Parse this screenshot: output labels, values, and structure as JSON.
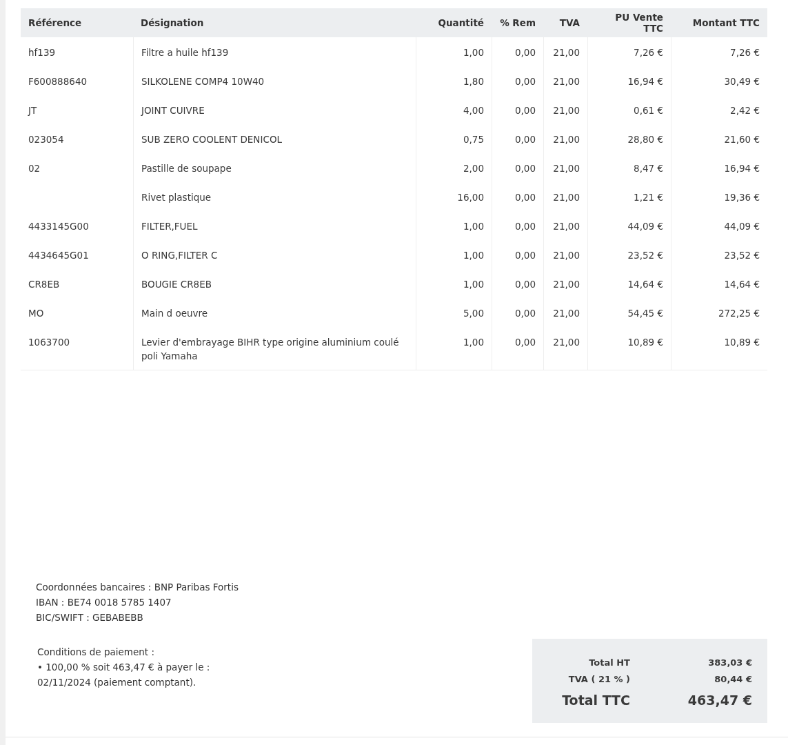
{
  "table": {
    "columns": [
      "Référence",
      "Désignation",
      "Quantité",
      "% Rem",
      "TVA",
      "PU Vente TTC",
      "Montant TTC"
    ],
    "rows": [
      [
        "hf139",
        "Filtre a huile hf139",
        "1,00",
        "0,00",
        "21,00",
        "7,26 €",
        "7,26 €"
      ],
      [
        "F600888640",
        "SILKOLENE COMP4 10W40",
        "1,80",
        "0,00",
        "21,00",
        "16,94 €",
        "30,49 €"
      ],
      [
        "JT",
        "JOINT CUIVRE",
        "4,00",
        "0,00",
        "21,00",
        "0,61 €",
        "2,42 €"
      ],
      [
        "023054",
        "SUB ZERO COOLENT DENICOL",
        "0,75",
        "0,00",
        "21,00",
        "28,80 €",
        "21,60 €"
      ],
      [
        "02",
        "Pastille de soupape",
        "2,00",
        "0,00",
        "21,00",
        "8,47 €",
        "16,94 €"
      ],
      [
        "",
        "Rivet plastique",
        "16,00",
        "0,00",
        "21,00",
        "1,21 €",
        "19,36 €"
      ],
      [
        "4433145G00",
        "FILTER,FUEL",
        "1,00",
        "0,00",
        "21,00",
        "44,09 €",
        "44,09 €"
      ],
      [
        "4434645G01",
        "O RING,FILTER C",
        "1,00",
        "0,00",
        "21,00",
        "23,52 €",
        "23,52 €"
      ],
      [
        "CR8EB",
        "BOUGIE CR8EB",
        "1,00",
        "0,00",
        "21,00",
        "14,64 €",
        "14,64 €"
      ],
      [
        "MO",
        "Main d oeuvre",
        "5,00",
        "0,00",
        "21,00",
        "54,45 €",
        "272,25 €"
      ],
      [
        "1063700",
        "Levier d'embrayage BIHR type origine aluminium coulé poli Yamaha",
        "1,00",
        "0,00",
        "21,00",
        "10,89 €",
        "10,89 €"
      ]
    ]
  },
  "bank": [
    "Coordonnées bancaires : BNP Paribas Fortis",
    "IBAN : BE74 0018 5785 1407",
    "BIC/SWIFT : GEBABEBB"
  ],
  "payment": [
    "Conditions de paiement :",
    "• 100,00 % soit 463,47 € à payer le :",
    "02/11/2024 (paiement comptant)."
  ],
  "totals": [
    {
      "kind": "sub",
      "label": "Total HT",
      "value": "383,03 €"
    },
    {
      "kind": "sub",
      "label": "TVA ( 21 % )",
      "value": "80,44 €"
    },
    {
      "kind": "grand",
      "label": "Total TTC",
      "value": "463,47 €"
    }
  ]
}
